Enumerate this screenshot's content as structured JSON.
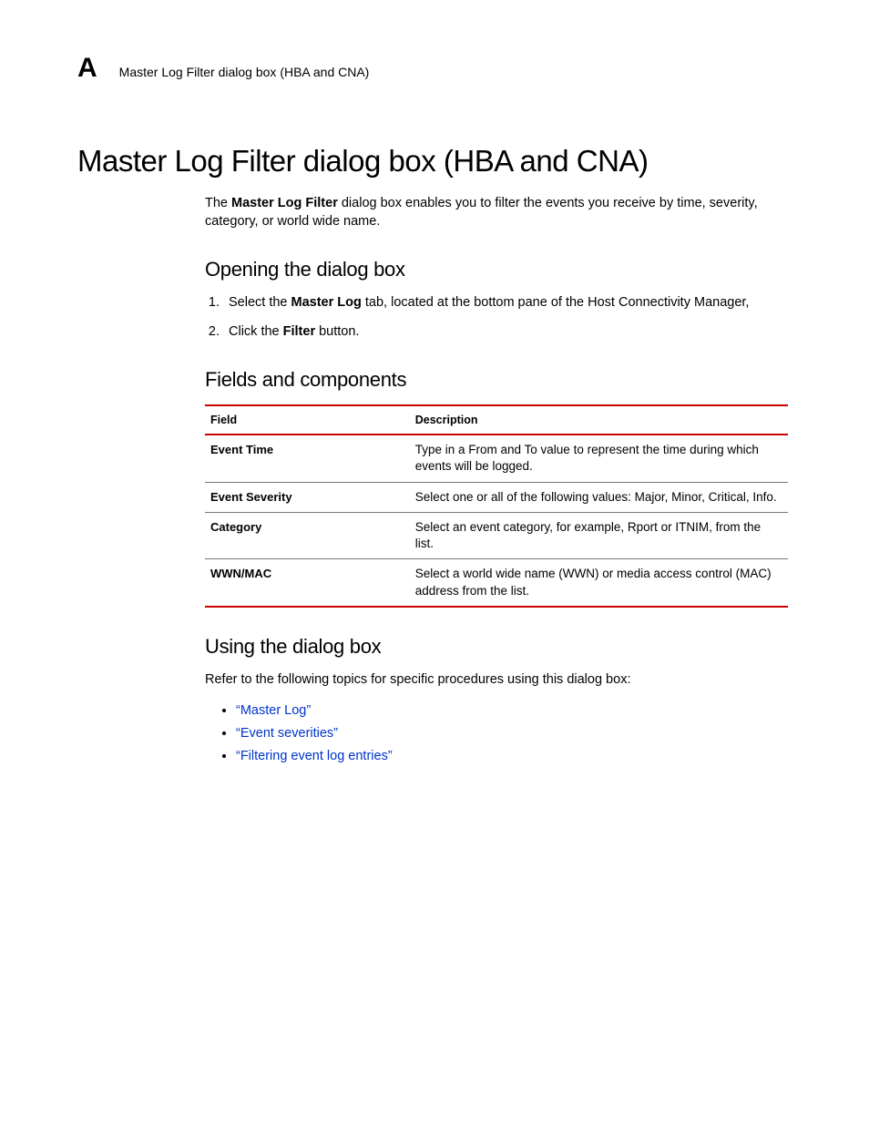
{
  "header": {
    "letter": "A",
    "running_title": "Master Log Filter dialog box (HBA and CNA)"
  },
  "title": "Master Log Filter dialog box (HBA and CNA)",
  "intro": {
    "pre": "The ",
    "bold": "Master Log Filter",
    "post": " dialog box enables you to filter the events you receive by time, severity, category, or world wide name."
  },
  "opening": {
    "heading": "Opening the dialog box",
    "steps": [
      {
        "pre": "Select the ",
        "bold": "Master Log",
        "post": " tab, located at the bottom pane of the Host Connectivity Manager,"
      },
      {
        "pre": "Click the ",
        "bold": "Filter",
        "post": " button."
      }
    ]
  },
  "fields": {
    "heading": "Fields and components",
    "col_field": "Field",
    "col_desc": "Description",
    "rows": [
      {
        "field": "Event Time",
        "desc": "Type in a From and To value to represent the time during which events will be logged."
      },
      {
        "field": "Event Severity",
        "desc": "Select one or all of the following values: Major, Minor, Critical, Info."
      },
      {
        "field": "Category",
        "desc": "Select an event category, for example, Rport or ITNIM, from the list."
      },
      {
        "field": "WWN/MAC",
        "desc": "Select a world wide name (WWN) or media access control (MAC) address from the list."
      }
    ]
  },
  "using": {
    "heading": "Using the dialog box",
    "intro": "Refer to the following topics for specific procedures using this dialog box:",
    "links": [
      "“Master Log”",
      "“Event severities”",
      "“Filtering event log entries”"
    ]
  }
}
